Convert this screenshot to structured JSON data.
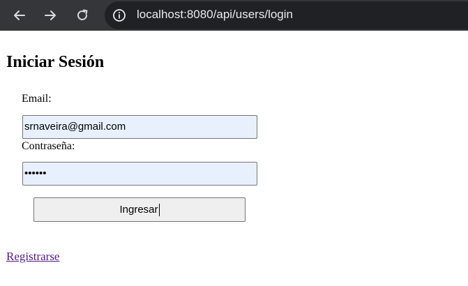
{
  "browser": {
    "url": "localhost:8080/api/users/login",
    "icons": {
      "back": "arrow-left-icon",
      "forward": "arrow-right-icon",
      "reload": "reload-icon",
      "site_info": "info-icon"
    }
  },
  "page": {
    "title": "Iniciar Sesión",
    "form": {
      "email_label": "Email:",
      "email_value": "srnaveira@gmail.com",
      "password_label": "Contraseña:",
      "password_value": "••••••",
      "submit_label": "Ingresar"
    },
    "register_link": "Registrarse"
  },
  "colors": {
    "chrome_bg": "#35363a",
    "omnibox_bg": "#202124",
    "autofill_bg": "#e8f0fe",
    "visited_link": "#551a8b"
  }
}
